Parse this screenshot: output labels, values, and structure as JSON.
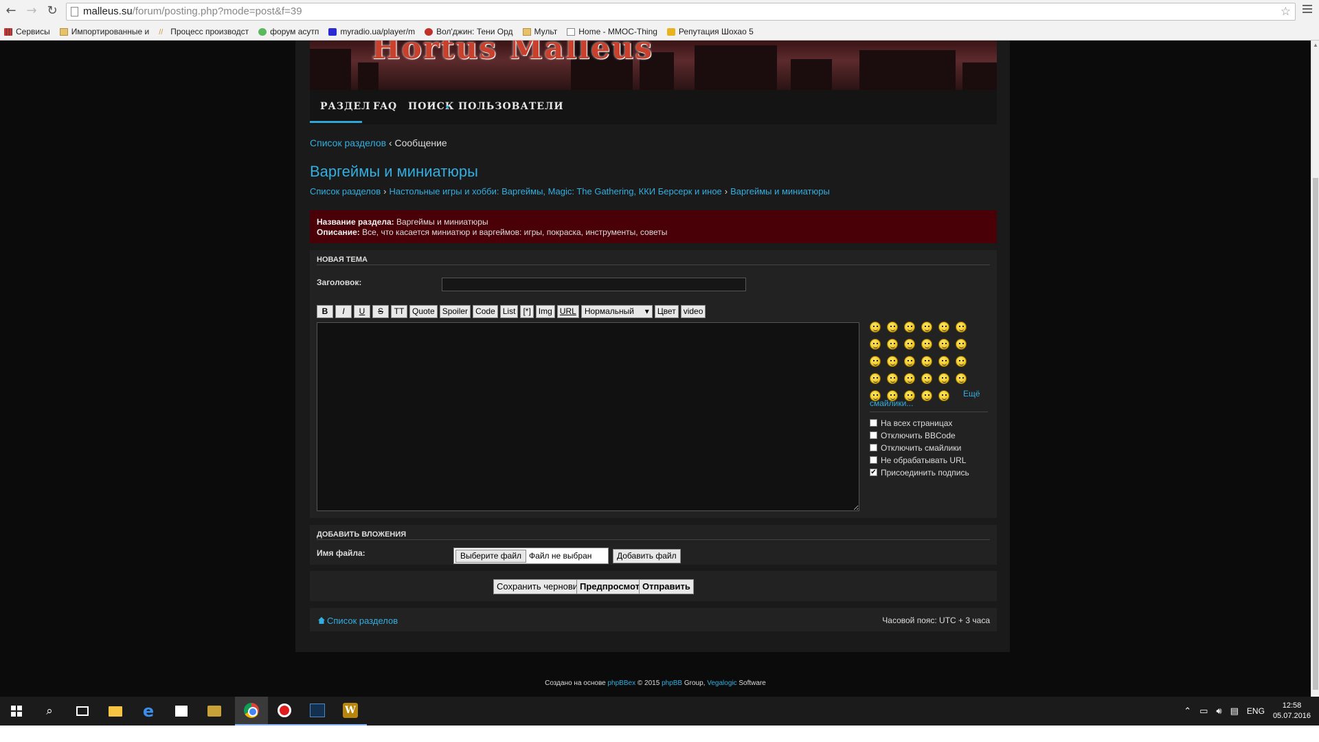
{
  "browser": {
    "url_host": "malleus.su",
    "url_path": "/forum/posting.php?mode=post&f=39",
    "bookmarks": [
      {
        "label": "Сервисы",
        "icon": "apps-icon"
      },
      {
        "label": "Импортированные и",
        "icon": "folder-icon"
      },
      {
        "label": "Процесс производст",
        "icon": "site-icon"
      },
      {
        "label": "форум асутп",
        "icon": "android-icon"
      },
      {
        "label": "myradio.ua/player/m",
        "icon": "radio-icon"
      },
      {
        "label": "Вол'джин: Тени Орд",
        "icon": "site-icon"
      },
      {
        "label": "Мульт",
        "icon": "folder-icon"
      },
      {
        "label": "Home - MMOC-Thing",
        "icon": "page-icon"
      },
      {
        "label": "Репутация Шохао 5",
        "icon": "site-icon"
      }
    ]
  },
  "header": {
    "logo_text": "Hortus Malleus",
    "nav": [
      "РАЗДЕЛ",
      "FAQ",
      "ПОИСК",
      "ПОЛЬЗОВАТЕЛИ"
    ]
  },
  "breadcrumb_top": {
    "root": "Список разделов",
    "sep": "‹",
    "current": "Сообщение"
  },
  "page_title": "Варгеймы и миниатюры",
  "breadcrumb_forum": [
    "Список разделов",
    "Настольные игры и хобби: Варгеймы, Magic: The Gathering, ККИ Берсерк и иное",
    "Варгеймы и миниатюры"
  ],
  "forum_info": {
    "name_label": "Название раздела:",
    "name_value": "Варгеймы и миниатюры",
    "desc_label": "Описание:",
    "desc_value": "Все, что касается миниатюр и варгеймов: игры, покраска, инструменты, советы"
  },
  "post_form": {
    "heading": "НОВАЯ ТЕМА",
    "subject_label": "Заголовок:",
    "subject_value": "",
    "toolbar": [
      "B",
      "I",
      "U",
      "S",
      "TT",
      "Quote",
      "Spoiler",
      "Code",
      "List",
      "[*]",
      "Img",
      "URL"
    ],
    "font_size": "Нормальный",
    "color_label": "Цвет",
    "video_label": "video",
    "more_smilies_1": "Ещё",
    "more_smilies_2": "смайлики...",
    "options": [
      {
        "label": "На всех страницах",
        "checked": false
      },
      {
        "label": "Отключить BBCode",
        "checked": false
      },
      {
        "label": "Отключить смайлики",
        "checked": false
      },
      {
        "label": "Не обрабатывать URL",
        "checked": false
      },
      {
        "label": "Присоединить подпись",
        "checked": true
      }
    ]
  },
  "attachments": {
    "heading": "ДОБАВИТЬ ВЛОЖЕНИЯ",
    "filename_label": "Имя файла:",
    "choose_label": "Выберите файл",
    "no_file_label": "Файл не выбран",
    "add_label": "Добавить файл"
  },
  "submit": {
    "save_draft": "Сохранить черновик",
    "preview": "Предпросмотр",
    "send": "Отправить"
  },
  "footer": {
    "home_link": "Список разделов",
    "timezone": "Часовой пояс: UTC + 3 часа",
    "copyright_pre": "Создано на основе",
    "copyright_phpbbex": "phpBBex",
    "copyright_mid": "© 2015",
    "copyright_phpbb": "phpBB",
    "copyright_group": "Group,",
    "copyright_vegalogic": "Vegalogic",
    "copyright_post": "Software"
  },
  "taskbar": {
    "lang": "ENG",
    "time": "12:58",
    "date": "05.07.2016"
  },
  "colors": {
    "link": "#33aee0",
    "forum_info_bg": "#4a0007",
    "panel_bg": "#222222"
  }
}
